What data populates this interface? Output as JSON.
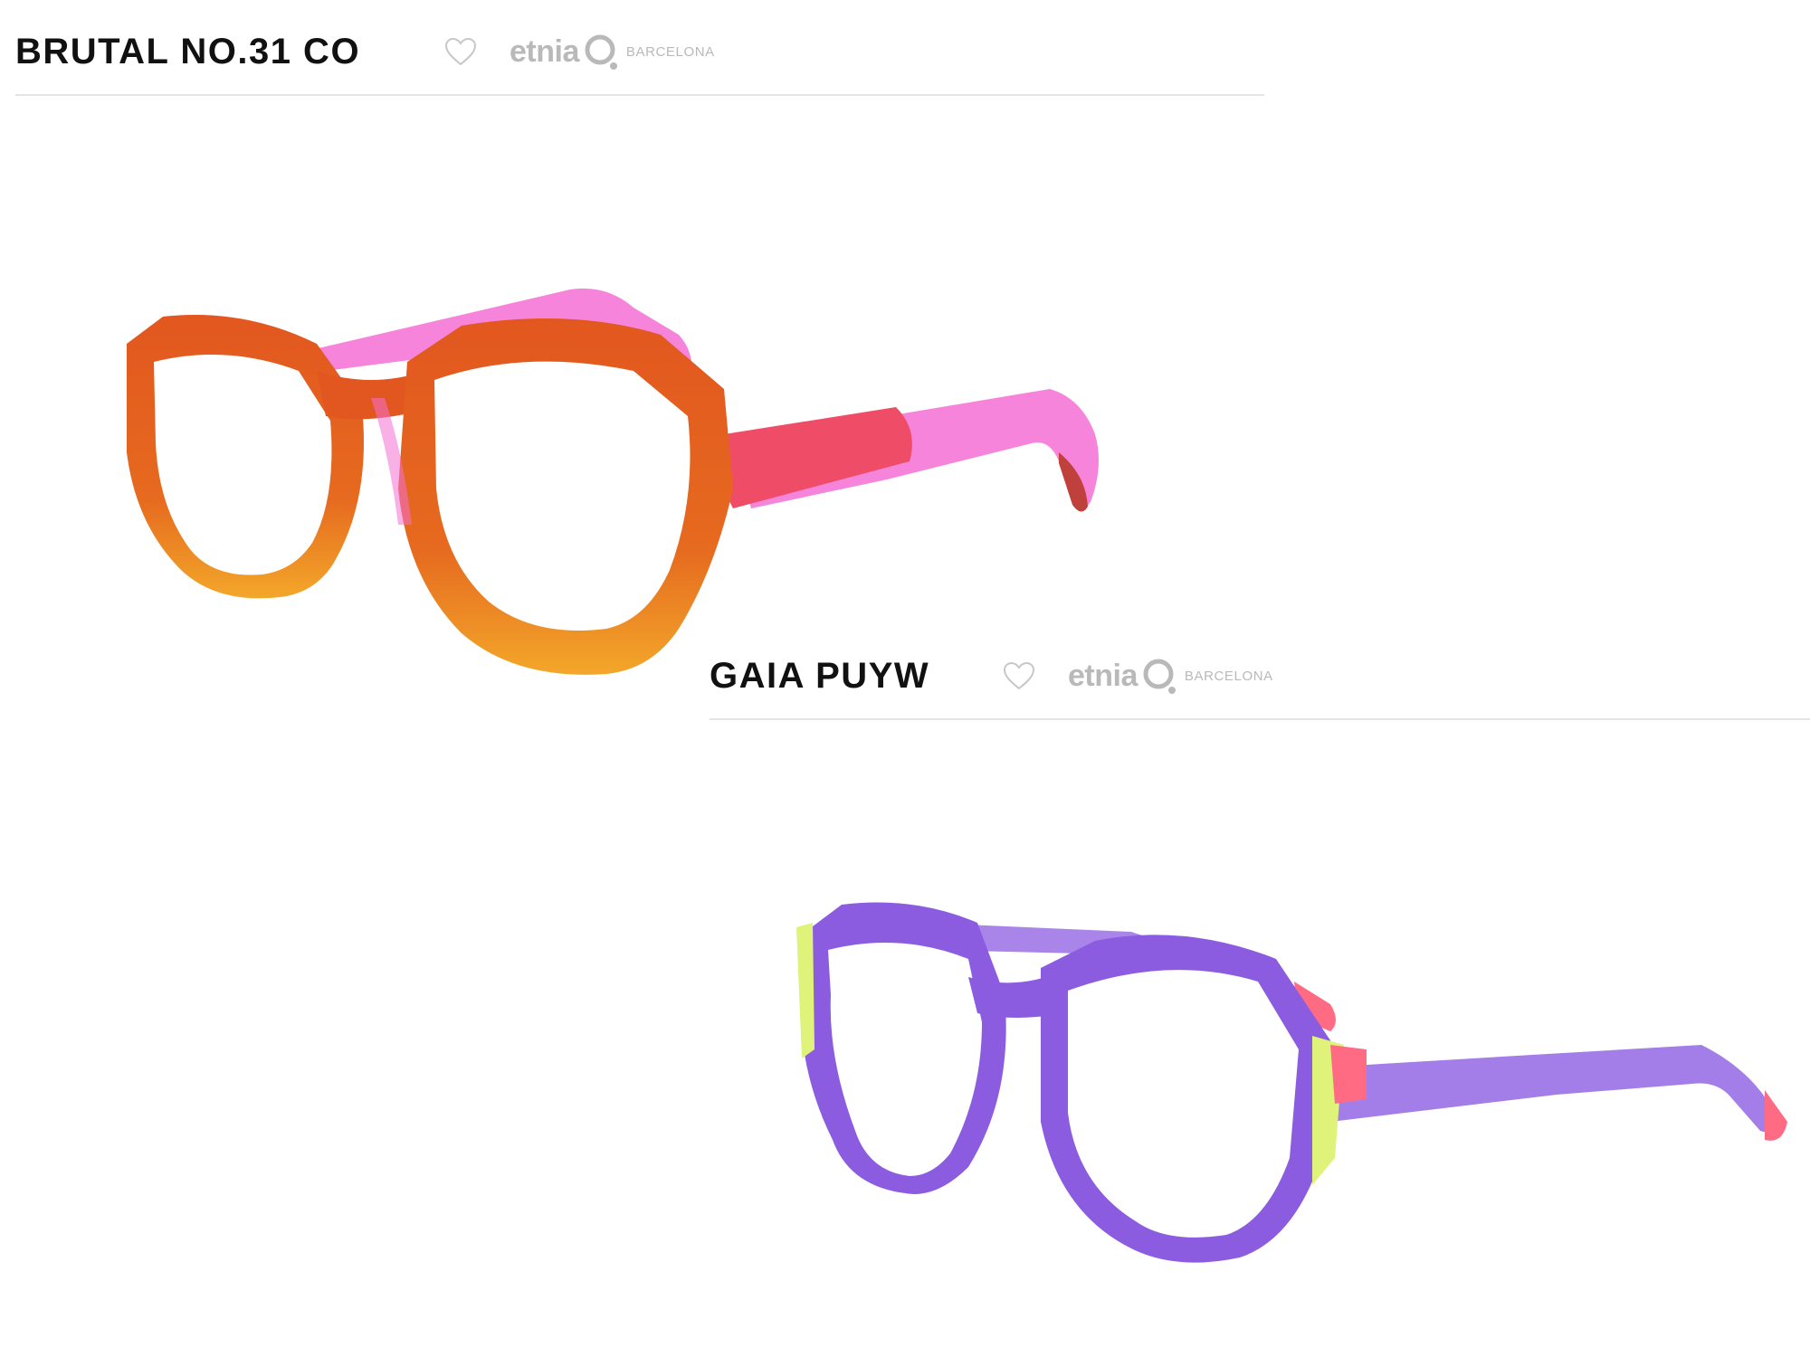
{
  "products": [
    {
      "name": "BRUTAL NO.31 CO",
      "brand": {
        "word": "etnia",
        "city": "BARCELONA"
      },
      "frame_colors": {
        "front": "#e2571f",
        "front_bottom": "#f3a72a",
        "temples": "#f46fd3",
        "temple_tip": "#c0413c"
      }
    },
    {
      "name": "GAIA PUYW",
      "brand": {
        "word": "etnia",
        "city": "BARCELONA"
      },
      "frame_colors": {
        "front": "#8b5ce0",
        "accent_yellow": "#dff27a",
        "accent_pink": "#ff6b82",
        "temples": "#9a70e6"
      }
    }
  ],
  "icons": {
    "favorite": "heart-outline-icon",
    "brand_logo": "etnia-logo-icon"
  }
}
